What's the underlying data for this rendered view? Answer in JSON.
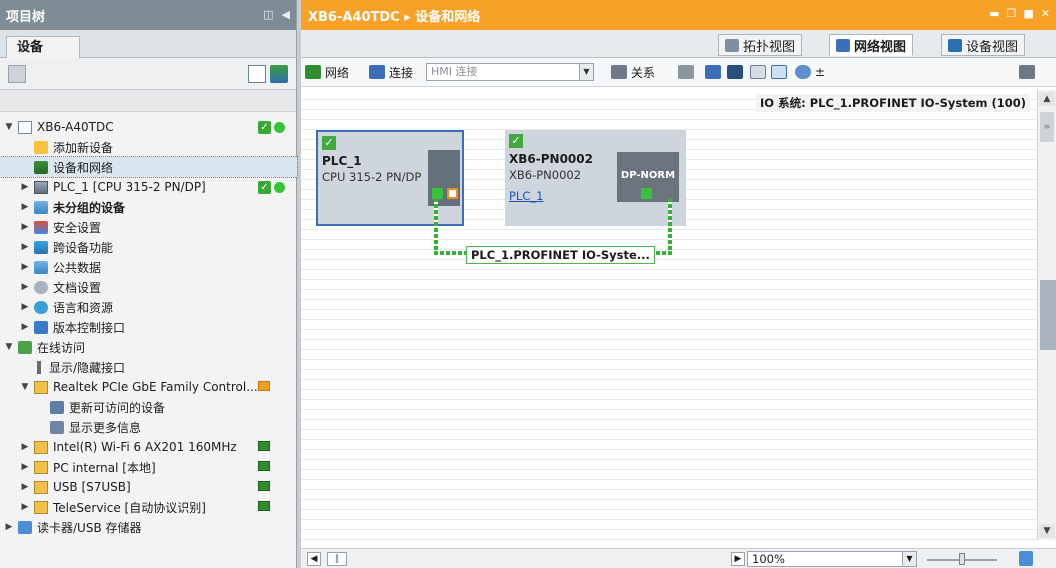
{
  "left_panel": {
    "title": "项目树",
    "tab": "设备",
    "tree": [
      {
        "label": "XB6-A40TDC",
        "expanded": true,
        "icon": "doc-icon",
        "bold": false,
        "status": [
          "check",
          "online"
        ]
      },
      {
        "label": "添加新设备",
        "icon": "add-device-icon",
        "bold": false
      },
      {
        "label": "设备和网络",
        "icon": "network-icon",
        "bold": false,
        "selected": true
      },
      {
        "label": "PLC_1 [CPU 315-2 PN/DP]",
        "icon": "plc-icon",
        "bold": false,
        "status": [
          "check",
          "online"
        ]
      },
      {
        "label": "未分组的设备",
        "icon": "device-group-icon",
        "bold": true
      },
      {
        "label": "安全设置",
        "icon": "security-icon",
        "bold": false
      },
      {
        "label": "跨设备功能",
        "icon": "cross-device-icon",
        "bold": false
      },
      {
        "label": "公共数据",
        "icon": "common-data-icon",
        "bold": false
      },
      {
        "label": "文档设置",
        "icon": "doc-settings-icon",
        "bold": false
      },
      {
        "label": "语言和资源",
        "icon": "language-icon",
        "bold": false
      },
      {
        "label": "版本控制接口",
        "icon": "version-control-icon",
        "bold": false
      },
      {
        "label": "在线访问",
        "icon": "online-access-icon",
        "bold": false,
        "expanded": true
      },
      {
        "label": "显示/隐藏接口",
        "icon": "pin-icon",
        "bold": false
      },
      {
        "label": "Realtek PCIe GbE Family Control...",
        "icon": "nic-icon",
        "bold": false,
        "expanded": true,
        "status": [
          "link-orange"
        ]
      },
      {
        "label": "更新可访问的设备",
        "icon": "update-accessible-icon",
        "bold": false
      },
      {
        "label": "显示更多信息",
        "icon": "more-info-icon",
        "bold": false
      },
      {
        "label": "Intel(R) Wi-Fi 6 AX201 160MHz",
        "icon": "nic-icon",
        "bold": false,
        "status": [
          "link"
        ]
      },
      {
        "label": "PC internal [本地]",
        "icon": "nic-icon",
        "bold": false,
        "status": [
          "link"
        ]
      },
      {
        "label": "USB [S7USB]",
        "icon": "nic-icon",
        "bold": false,
        "status": [
          "link"
        ]
      },
      {
        "label": "TeleService [自动协议识别]",
        "icon": "nic-icon",
        "bold": false,
        "status": [
          "link"
        ]
      },
      {
        "label": "读卡器/USB 存储器",
        "icon": "card-reader-icon",
        "bold": false
      }
    ]
  },
  "right_panel": {
    "title": "XB6-A40TDC ▸ 设备和网络",
    "view_tabs": [
      "拓扑视图",
      "网络视图",
      "设备视图"
    ],
    "active_view_tab": "网络视图",
    "toolbar": {
      "network_label": "网络",
      "connection_label": "连接",
      "hmi_select": "HMI 连接",
      "relations_label": "关系",
      "zoom_in_label": "±"
    },
    "io_system_label": "IO 系统: PLC_1.PROFINET IO-System (100)",
    "devices": [
      {
        "name": "PLC_1",
        "type": "CPU 315-2 PN/DP"
      },
      {
        "name": "XB6-PN0002",
        "type": "XB6-PN0002",
        "link": "PLC_1",
        "module_label": "DP-NORM"
      }
    ],
    "profinet_label": "PLC_1.PROFINET IO-Syste...",
    "zoom": "100%"
  }
}
